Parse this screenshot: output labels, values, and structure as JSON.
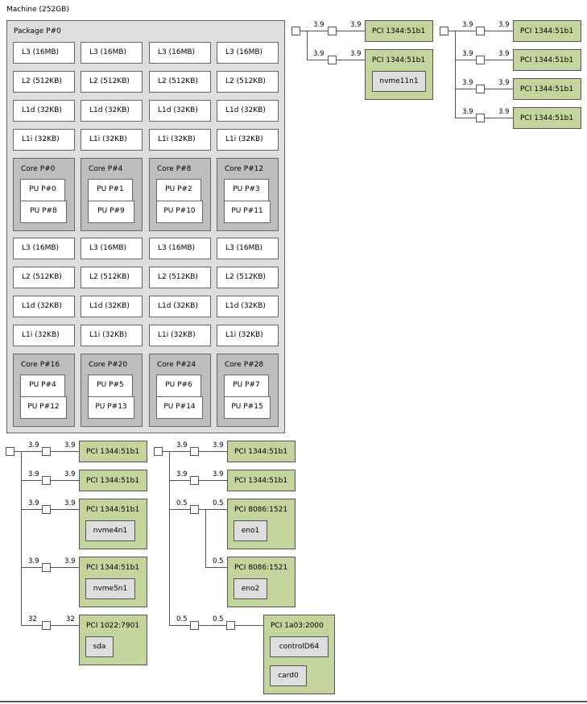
{
  "machine": {
    "label": "Machine (252GB)"
  },
  "package": {
    "label": "Package P#0",
    "groups": [
      {
        "caches": [
          [
            "L3 (16MB)",
            "L3 (16MB)",
            "L3 (16MB)",
            "L3 (16MB)"
          ],
          [
            "L2 (512KB)",
            "L2 (512KB)",
            "L2 (512KB)",
            "L2 (512KB)"
          ],
          [
            "L1d (32KB)",
            "L1d (32KB)",
            "L1d (32KB)",
            "L1d (32KB)"
          ],
          [
            "L1i (32KB)",
            "L1i (32KB)",
            "L1i (32KB)",
            "L1i (32KB)"
          ]
        ],
        "cores": [
          {
            "label": "Core P#0",
            "pus": [
              "PU P#0",
              "PU P#8"
            ]
          },
          {
            "label": "Core P#4",
            "pus": [
              "PU P#1",
              "PU P#9"
            ]
          },
          {
            "label": "Core P#8",
            "pus": [
              "PU P#2",
              "PU P#10"
            ]
          },
          {
            "label": "Core P#12",
            "pus": [
              "PU P#3",
              "PU P#11"
            ]
          }
        ]
      },
      {
        "caches": [
          [
            "L3 (16MB)",
            "L3 (16MB)",
            "L3 (16MB)",
            "L3 (16MB)"
          ],
          [
            "L2 (512KB)",
            "L2 (512KB)",
            "L2 (512KB)",
            "L2 (512KB)"
          ],
          [
            "L1d (32KB)",
            "L1d (32KB)",
            "L1d (32KB)",
            "L1d (32KB)"
          ],
          [
            "L1i (32KB)",
            "L1i (32KB)",
            "L1i (32KB)",
            "L1i (32KB)"
          ]
        ],
        "cores": [
          {
            "label": "Core P#16",
            "pus": [
              "PU P#4",
              "PU P#12"
            ]
          },
          {
            "label": "Core P#20",
            "pus": [
              "PU P#5",
              "PU P#13"
            ]
          },
          {
            "label": "Core P#24",
            "pus": [
              "PU P#6",
              "PU P#14"
            ]
          },
          {
            "label": "Core P#28",
            "pus": [
              "PU P#7",
              "PU P#15"
            ]
          }
        ]
      }
    ]
  },
  "pci_trees": {
    "tree_a": {
      "branches": [
        {
          "speed_in": "3.9",
          "speed_out": "3.9",
          "device": "PCI 1344:51b1",
          "children": []
        },
        {
          "speed_in": "3.9",
          "speed_out": "3.9",
          "device": "PCI 1344:51b1",
          "children": [
            "nvme11n1"
          ]
        }
      ]
    },
    "tree_b": {
      "branches": [
        {
          "speed_in": "3.9",
          "speed_out": "3.9",
          "device": "PCI 1344:51b1",
          "children": []
        },
        {
          "speed_in": "3.9",
          "speed_out": "3.9",
          "device": "PCI 1344:51b1",
          "children": []
        },
        {
          "speed_in": "3.9",
          "speed_out": "3.9",
          "device": "PCI 1344:51b1",
          "children": []
        },
        {
          "speed_in": "3.9",
          "speed_out": "3.9",
          "device": "PCI 1344:51b1",
          "children": []
        }
      ]
    },
    "tree_c": {
      "branches": [
        {
          "speed_in": "3.9",
          "speed_out": "3.9",
          "device": "PCI 1344:51b1",
          "children": []
        },
        {
          "speed_in": "3.9",
          "speed_out": "3.9",
          "device": "PCI 1344:51b1",
          "children": []
        },
        {
          "speed_in": "3.9",
          "speed_out": "3.9",
          "device": "PCI 1344:51b1",
          "children": [
            "nvme4n1"
          ]
        },
        {
          "speed_in": "3.9",
          "speed_out": "3.9",
          "device": "PCI 1344:51b1",
          "children": [
            "nvme5n1"
          ]
        },
        {
          "speed_in": "32",
          "speed_out": "32",
          "device": "PCI 1022:7901",
          "children": [
            "sda"
          ]
        }
      ]
    },
    "tree_d": {
      "branches": [
        {
          "speed_in": "3.9",
          "speed_out": "3.9",
          "device": "PCI 1344:51b1",
          "children": []
        },
        {
          "speed_in": "3.9",
          "speed_out": "3.9",
          "device": "PCI 1344:51b1",
          "children": []
        },
        {
          "speed_in": "0.5",
          "speed_out": "0.5",
          "device": "PCI 8086:1521",
          "children": [
            "eno1"
          ]
        },
        {
          "speed_in": "",
          "speed_out": "0.5",
          "device": "PCI 8086:1521",
          "children": [
            "eno2"
          ]
        },
        {
          "speed_in": "0.5",
          "speed_out": "0.5",
          "device": "PCI 1a03:2000",
          "children": [
            "controlD64",
            "card0"
          ]
        }
      ]
    }
  }
}
